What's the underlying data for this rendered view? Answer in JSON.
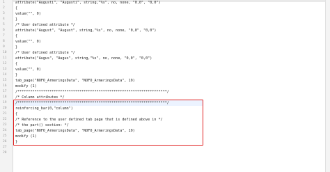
{
  "editor": {
    "lines": [
      {
        "n": "1",
        "text": "attribute(\"Augusti\", \"Augusti\", string,\"%s\", no, none, \"0,0\", \"0,0\")"
      },
      {
        "n": "2",
        "text": "{"
      },
      {
        "n": "3",
        "text": "value(\"\", 0)"
      },
      {
        "n": "4",
        "text": "}"
      },
      {
        "n": "5",
        "text": "/* User defined attribute */"
      },
      {
        "n": "6",
        "text": "attribute(\"August\", \"August\", string,\"%s\", no, none, \"0,0\", \"0,0\")"
      },
      {
        "n": "7",
        "text": "{"
      },
      {
        "n": "8",
        "text": "value(\"\", 0)"
      },
      {
        "n": "9",
        "text": "}"
      },
      {
        "n": "10",
        "text": "/* User defined attribute */"
      },
      {
        "n": "11",
        "text": "attribute(\"Augus\", \"Augus\", string,\"%s\", no, none, \"0,0\", \"0,0\")"
      },
      {
        "n": "12",
        "text": "{"
      },
      {
        "n": "13",
        "text": "value(\"\", 0)"
      },
      {
        "n": "14",
        "text": "}"
      },
      {
        "n": "15",
        "text": "tab_page(\"NOFO_ArmeringsData\", \"NOFO_ArmeringsData\", 19)"
      },
      {
        "n": "16",
        "text": "modify (1)"
      },
      {
        "n": "17",
        "text": "/**********************************************************************/"
      },
      {
        "n": "18",
        "text": "/* Column attributes */"
      },
      {
        "n": "19",
        "text": "/**********************************************************************/"
      },
      {
        "n": "20",
        "text": "reinforcing_bar(0,\"column\")"
      },
      {
        "n": "21",
        "text": "{"
      },
      {
        "n": "22",
        "text": "/* Reference to the user defined tab page that is defined above in */"
      },
      {
        "n": "23",
        "text": "/* the part() section: */"
      },
      {
        "n": "24",
        "text": "tab_page(\"NOFO_ArmeringsData\", \"NOFO_ArmeringsData\", 19)"
      },
      {
        "n": "25",
        "text": "modify (1)"
      },
      {
        "n": "26",
        "text": "}"
      },
      {
        "n": "27",
        "text": ""
      },
      {
        "n": "28",
        "text": ""
      }
    ]
  }
}
